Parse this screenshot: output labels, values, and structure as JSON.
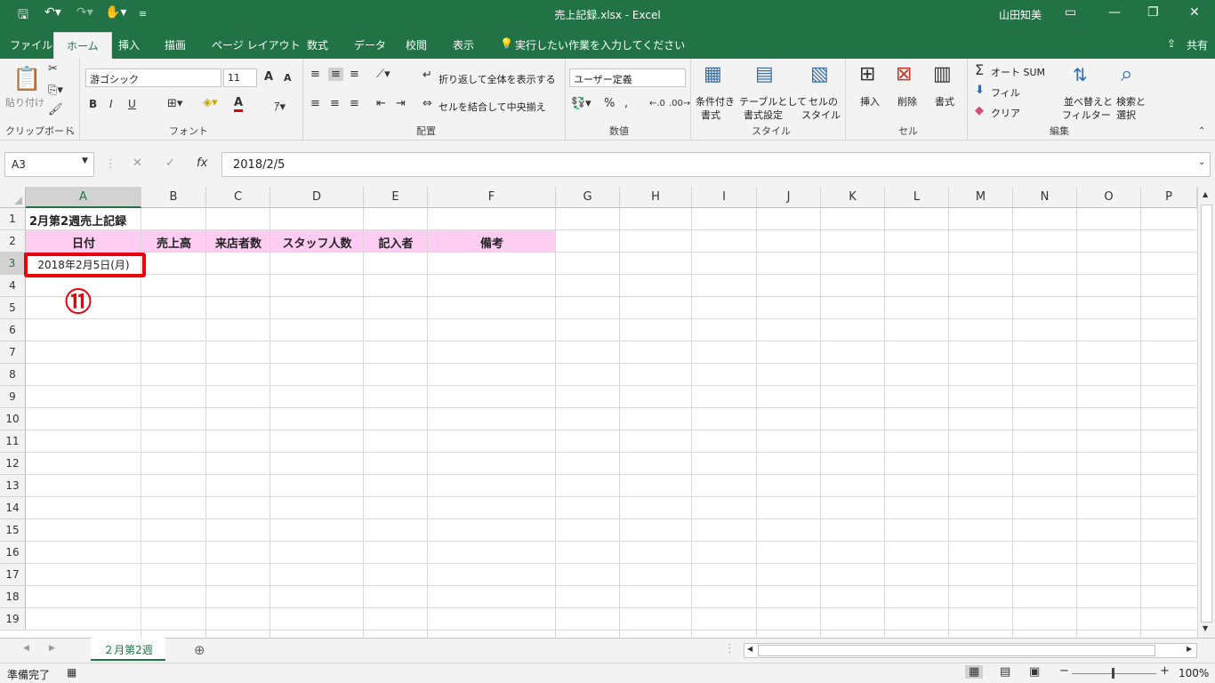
{
  "app": {
    "title": "売上記録.xlsx  -  Excel",
    "user": "山田知美",
    "qat_icons": [
      "save-icon",
      "undo-icon",
      "redo-icon",
      "touch-mode-icon",
      "customize-icon"
    ],
    "window_buttons": [
      "ribbon-display-icon",
      "minimize-icon",
      "restore-icon",
      "close-icon"
    ]
  },
  "tabs": [
    "ファイル",
    "ホーム",
    "挿入",
    "描画",
    "ページ レイアウト",
    "数式",
    "データ",
    "校閲",
    "表示"
  ],
  "active_tab": "ホーム",
  "tell_me": "実行したい作業を入力してください",
  "share": "共有",
  "ribbon": {
    "clipboard": {
      "label": "クリップボード",
      "paste": "貼り付け"
    },
    "font": {
      "label": "フォント",
      "name": "游ゴシック",
      "size": "11",
      "bold": "B",
      "italic": "I",
      "underline": "U",
      "grow": "A",
      "shrink": "A",
      "color_glyph": "A"
    },
    "alignment": {
      "label": "配置",
      "wrap": "折り返して全体を表示する",
      "merge": "セルを結合して中央揃え"
    },
    "number": {
      "label": "数値",
      "format": "ユーザー定義",
      "percent": "%",
      "comma": ","
    },
    "styles": {
      "label": "スタイル",
      "cond1": "条件付き",
      "cond2": "書式",
      "table1": "テーブルとして",
      "table2": "書式設定",
      "cell1": "セルの",
      "cell2": "スタイル"
    },
    "cells": {
      "label": "セル",
      "insert": "挿入",
      "delete": "削除",
      "format": "書式"
    },
    "editing": {
      "label": "編集",
      "autosum": "オート SUM",
      "fill": "フィル",
      "clear": "クリア",
      "sort1": "並べ替えと",
      "sort2": "フィルター",
      "find1": "検索と",
      "find2": "選択"
    }
  },
  "formula_bar": {
    "name_box": "A3",
    "fx": "fx",
    "value": "2018/2/5"
  },
  "columns": [
    "A",
    "B",
    "C",
    "D",
    "E",
    "F",
    "G",
    "H",
    "I",
    "J",
    "K",
    "L",
    "M",
    "N",
    "O",
    "P"
  ],
  "selected_column": "A",
  "rows": [
    "1",
    "2",
    "3",
    "4",
    "5",
    "6",
    "7",
    "8",
    "9",
    "10",
    "11",
    "12",
    "13",
    "14",
    "15",
    "16",
    "17",
    "18",
    "19"
  ],
  "selected_row": "3",
  "cells": {
    "A1": "2月第2週売上記録",
    "A2": "日付",
    "B2": "売上高",
    "C2": "来店者数",
    "D2": "スタッフ人数",
    "E2": "記入者",
    "F2": "備考",
    "A3": "2018年2月5日(月)"
  },
  "annotation": "⑪",
  "header_fill_color": "#ffccf2",
  "highlight_color": "#e8000b",
  "sheet_tab": "２月第2週",
  "status": {
    "ready": "準備完了",
    "zoom": "100%"
  }
}
